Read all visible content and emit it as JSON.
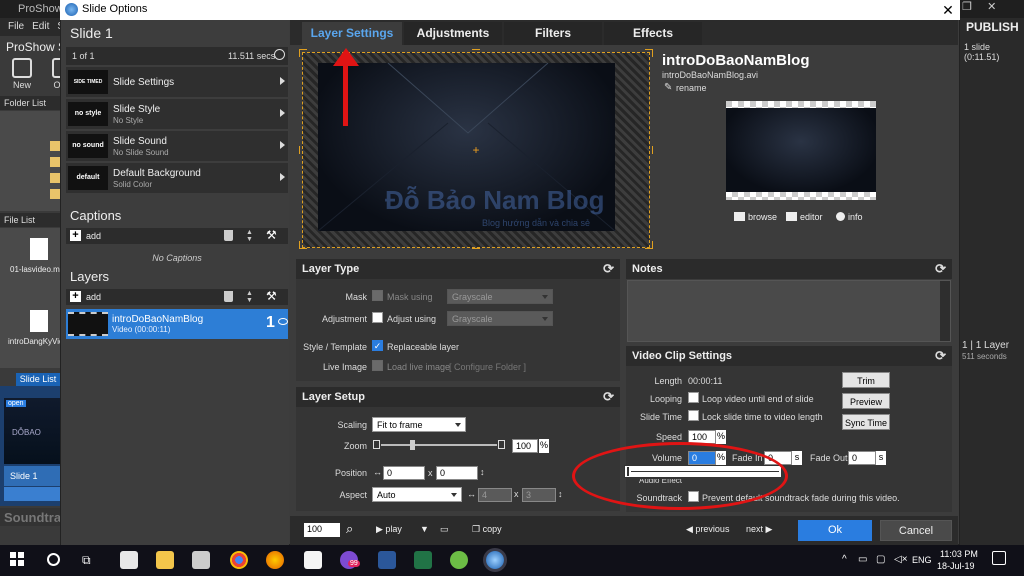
{
  "background_app": {
    "title": "ProShow Pr",
    "menu": [
      "File",
      "Edit",
      "Sl"
    ],
    "app_name": "ProShow Sl",
    "tools": [
      "New",
      "Ope"
    ],
    "folder_list": "Folder List",
    "file_list": "File List",
    "files": [
      "01-lasvideo.mp",
      "introDangKyVid"
    ],
    "slide_list_tab": "Slide List",
    "slide_thumb_text": "open",
    "slide_thumb_logo": "DỖBAO",
    "slide_label": "Slide 1",
    "soundtrack": "Soundtrack",
    "publish": "PUBLISH",
    "slide_count": "1 slide (0:11.51)",
    "layer_info": "1 | 1 Layer",
    "secs": "511 seconds"
  },
  "dialog": {
    "title": "Slide Options",
    "close": "✕"
  },
  "left": {
    "slide_title": "Slide 1",
    "slide_of": "1 of 1",
    "slide_secs": "11.511 secs",
    "rows": [
      {
        "thumb": "SIDE TIMED",
        "title": "Slide Settings",
        "sub": ""
      },
      {
        "thumb": "no style",
        "title": "Slide Style",
        "sub": "No Style"
      },
      {
        "thumb": "no sound",
        "title": "Slide Sound",
        "sub": "No Slide Sound"
      },
      {
        "thumb": "default",
        "title": "Default Background",
        "sub": "Solid Color"
      }
    ],
    "captions_title": "Captions",
    "captions_add": "add",
    "no_captions": "No Captions",
    "layers_title": "Layers",
    "layers_add": "add",
    "layer": {
      "name": "introDoBaoNamBlog",
      "duration": "Video (00:00:11)",
      "number": "1"
    }
  },
  "tabs": [
    "Layer Settings",
    "Adjustments",
    "Filters",
    "Effects"
  ],
  "active_tab": "Layer Settings",
  "preview": {
    "watermark_title": "Đỗ Bảo Nam Blog",
    "watermark_sub": "Blog hướng dẫn và chia sẻ"
  },
  "file_info": {
    "name": "introDoBaoNamBlog",
    "file": "introDoBaoNamBlog.avi",
    "rename": "rename",
    "actions": [
      "browse",
      "editor",
      "info"
    ]
  },
  "layer_type": {
    "title": "Layer Type",
    "mask_label": "Mask",
    "mask_using": "Mask using",
    "mask_select": "Grayscale",
    "adjustment_label": "Adjustment",
    "adjust_using": "Adjust using",
    "adjust_select": "Grayscale",
    "style_label": "Style / Template",
    "replaceable": "Replaceable layer",
    "live_label": "Live Image",
    "load_live": "Load live image",
    "configure": "[ Configure Folder ]"
  },
  "layer_setup": {
    "title": "Layer Setup",
    "scaling_label": "Scaling",
    "scaling_value": "Fit to frame",
    "zoom_label": "Zoom",
    "zoom_value": "100",
    "zoom_unit": "%",
    "position_label": "Position",
    "pos_x": "0",
    "pos_y": "0",
    "aspect_label": "Aspect",
    "aspect_value": "Auto",
    "aspect_x": "4",
    "aspect_y": "3",
    "x_sep": "x"
  },
  "notes": {
    "title": "Notes"
  },
  "video_clip": {
    "title": "Video Clip Settings",
    "length_label": "Length",
    "length_value": "00:00:11",
    "looping_label": "Looping",
    "loop_text": "Loop video until end of slide",
    "slide_time_label": "Slide Time",
    "lock_text": "Lock slide time to video length",
    "speed_label": "Speed",
    "speed_value": "100",
    "volume_label": "Volume",
    "volume_value": "0",
    "fade_in_label": "Fade In",
    "fade_in_value": "0",
    "fade_out_label": "Fade Out",
    "fade_out_value": "0",
    "unit_pct": "%",
    "unit_s": "s",
    "audio_effect_label": "Audio Effect",
    "soundtrack_label": "Soundtrack",
    "soundtrack_text": "Prevent default soundtrack fade during this video.",
    "trim": "Trim",
    "preview": "Preview",
    "sync": "Sync Time"
  },
  "bottom": {
    "zoom": "100",
    "play": "play",
    "copy": "copy",
    "previous": "previous",
    "next": "next",
    "ok": "Ok",
    "cancel": "Cancel"
  },
  "taskbar": {
    "lang": "ENG",
    "time": "11:03 PM",
    "date": "18-Jul-19",
    "badge": "99"
  },
  "colors": {
    "accent": "#2a7de0",
    "annotation": "#e01414",
    "tab_active": "#5aa6ee"
  }
}
